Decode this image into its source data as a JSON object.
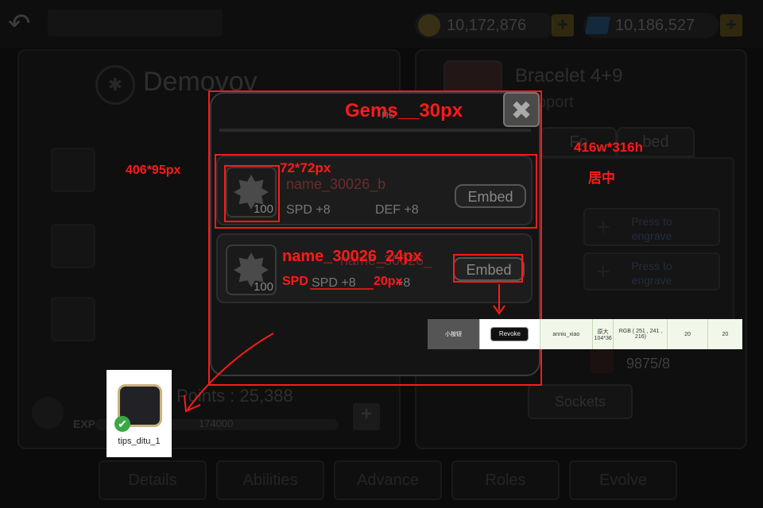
{
  "currency": {
    "gold": "10,172,876",
    "diamonds": "10,186,527"
  },
  "character": {
    "name": "Demovov",
    "points": "Points : 25,388",
    "exp_label": "EXP",
    "exp_value": "174000"
  },
  "item": {
    "title": "Bracelet 4+9",
    "subtitle": "pport",
    "tabs": [
      "Fo",
      "bed"
    ],
    "engrave": [
      "Press to\nengrave",
      "Press to\nengrave"
    ],
    "count": "9875/8",
    "sockets_label": "Sockets"
  },
  "bottom_nav": [
    "Details",
    "Abilities",
    "Advance",
    "Roles",
    "Evolve"
  ],
  "modal": {
    "title": "ns",
    "close": "✖",
    "gems": [
      {
        "count": "100",
        "name": "name_30026_b",
        "stats": [
          "SPD +8",
          "DEF +8"
        ],
        "action": "Embed"
      },
      {
        "count": "100",
        "name": "name_30026_",
        "stats": [
          "SPD +8",
          "+8"
        ],
        "action": "Embed"
      }
    ]
  },
  "annotations": {
    "title_spec": "Gems__30px",
    "modal_size": "416w*316h",
    "centered": "居中",
    "row_size": "406*95px",
    "icon_size": "72*72px",
    "name_spec": "name_30026_24px",
    "stat_spec_a": "SPD",
    "stat_spec_b": "20px",
    "spec_table": [
      "小按钮",
      "Revoke",
      "anniu_xiao",
      "原大\n104*36",
      "RGB ( 251 , 241 , 216)",
      "20",
      "20"
    ],
    "tips_label": "tips_ditu_1"
  },
  "colors": {
    "annotation": "#ff1a1a",
    "tips_border": "#c9b27a",
    "check": "#3aa845"
  }
}
